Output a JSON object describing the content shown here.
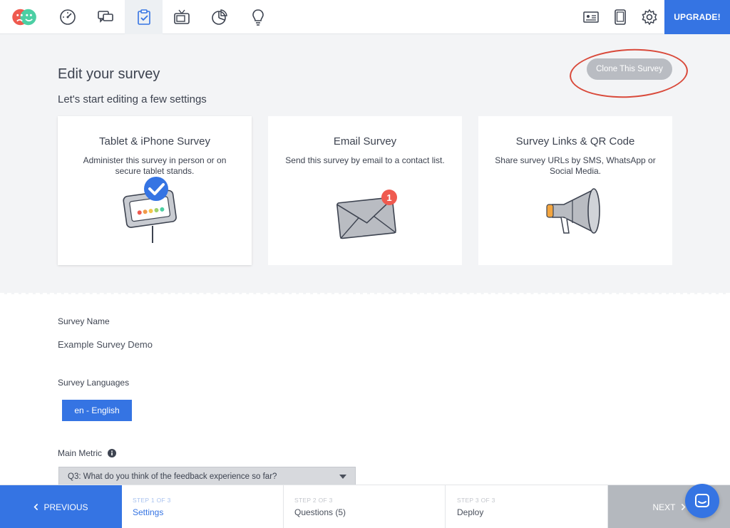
{
  "nav": {
    "icons": [
      "faces-logo-icon",
      "dashboard-gauge-icon",
      "chat-bubbles-icon",
      "clipboard-survey-icon",
      "tv-icon",
      "pie-chart-icon",
      "lightbulb-icon"
    ],
    "right_icons": [
      "contact-card-icon",
      "tablet-icon",
      "gear-icon"
    ],
    "upgrade_label": "UPGRADE!"
  },
  "header": {
    "title": "Edit your survey",
    "subtitle": "Let's start editing a few settings",
    "clone_label": "Clone This Survey"
  },
  "cards": [
    {
      "title": "Tablet & iPhone Survey",
      "desc": "Administer this survey in person or on secure tablet stands."
    },
    {
      "title": "Email Survey",
      "desc": "Send this survey by email to a contact list.",
      "badge": "1"
    },
    {
      "title": "Survey Links & QR Code",
      "desc": "Share survey URLs by SMS, WhatsApp or Social Media."
    }
  ],
  "form": {
    "name_label": "Survey Name",
    "name_value": "Example Survey Demo",
    "languages_label": "Survey Languages",
    "language_value": "en - English",
    "metric_label": "Main Metric",
    "metric_value": "Q3: What do you think of the feedback experience so far?"
  },
  "steps": {
    "prev_label": "PREVIOUS",
    "next_label": "NEXT",
    "items": [
      {
        "num": "STEP 1 OF 3",
        "name": "Settings"
      },
      {
        "num": "STEP 2 OF 3",
        "name": "Questions (5)"
      },
      {
        "num": "STEP 3 OF 3",
        "name": "Deploy"
      }
    ]
  },
  "colors": {
    "accent": "#3574e3",
    "annotation": "#d9493a",
    "hero_bg": "#f3f4f6"
  }
}
